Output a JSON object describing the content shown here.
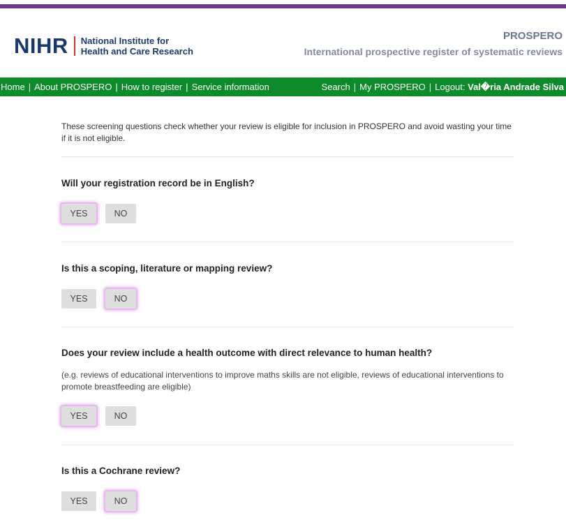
{
  "header": {
    "logo_mark": "NIHR",
    "logo_line1": "National Institute for",
    "logo_line2": "Health and Care Research",
    "brand_title": "PROSPERO",
    "brand_subtitle": "International prospective register of systematic reviews"
  },
  "nav": {
    "left": [
      "Home",
      "About PROSPERO",
      "How to register",
      "Service information"
    ],
    "search": "Search",
    "my": "My PROSPERO",
    "logout": "Logout:",
    "user": "Val�ria Andrade Silva",
    "separator": "|"
  },
  "intro": "These screening questions check whether your review is eligible for inclusion in PROSPERO and avoid wasting your time if it is not eligible.",
  "questions": [
    {
      "text": "Will your registration record be in English?",
      "note": "",
      "yes": "YES",
      "no": "NO",
      "selected": "YES"
    },
    {
      "text": "Is this a scoping, literature or mapping review?",
      "note": "",
      "yes": "YES",
      "no": "NO",
      "selected": "NO"
    },
    {
      "text": "Does your review include a health outcome with direct relevance to human health?",
      "note": "(e.g. reviews of educational interventions to improve maths skills are not eligible, reviews of educational interventions to promote breastfeeding are eligible)",
      "yes": "YES",
      "no": "NO",
      "selected": "YES"
    },
    {
      "text": "Is this a Cochrane review?",
      "note": "",
      "yes": "YES",
      "no": "NO",
      "selected": "NO"
    }
  ],
  "colors": {
    "top_bar": "#6b3a8a",
    "nav_bg": "#0d8a2a",
    "brand": "#6d7690",
    "logo": "#1b3a6b",
    "selected_glow": "#d9a0e4"
  }
}
